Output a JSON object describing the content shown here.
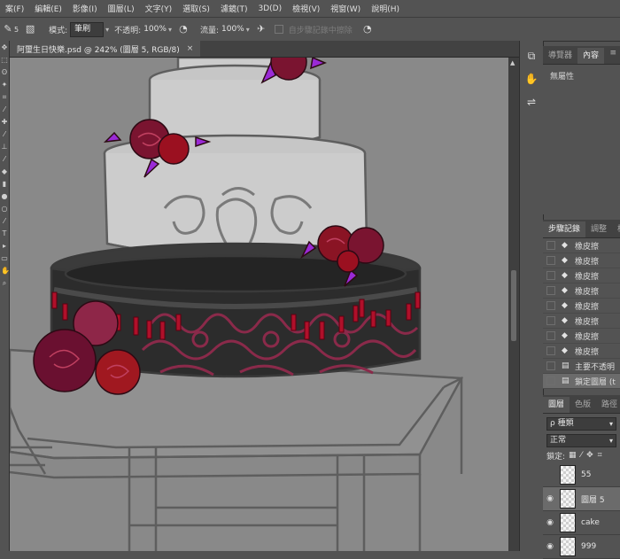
{
  "menu": {
    "items": [
      "案(F)",
      "編輯(E)",
      "影像(I)",
      "圖層(L)",
      "文字(Y)",
      "選取(S)",
      "濾鏡(T)",
      "3D(D)",
      "檢視(V)",
      "視窗(W)",
      "說明(H)"
    ]
  },
  "options": {
    "brush_size": "5",
    "mode_label": "模式:",
    "mode_value": "筆刷",
    "opacity_label": "不透明:",
    "opacity_value": "100%",
    "flow_label": "流量:",
    "flow_value": "100%",
    "erase_history_label": "自步驟記錄中擦除"
  },
  "document": {
    "tab_title": "阿璽生日快樂.psd @ 242% (圖層 5, RGB/8)",
    "close_glyph": "×"
  },
  "panel_top": {
    "tabs": [
      "導覽器",
      "內容"
    ],
    "active_tab": 1,
    "content_text": "無屬性",
    "menu_glyph": "≡"
  },
  "history_panel": {
    "tabs": [
      "步驟記錄",
      "調整",
      "樣"
    ],
    "items": [
      "橡皮擦",
      "橡皮擦",
      "橡皮擦",
      "橡皮擦",
      "橡皮擦",
      "橡皮擦",
      "橡皮擦",
      "橡皮擦",
      "主要不透明",
      "鎖定圖層 (t"
    ],
    "active_index": 9
  },
  "layers_panel": {
    "tabs": [
      "圖層",
      "色版",
      "路徑"
    ],
    "filter_value": "ρ 種類",
    "blend_value": "正常",
    "lock_label": "鎖定:",
    "layers": [
      {
        "name": "55",
        "visible": false
      },
      {
        "name": "圖層 5",
        "visible": true
      },
      {
        "name": "cake",
        "visible": true
      },
      {
        "name": "999",
        "visible": true
      }
    ],
    "selected_index": 1,
    "eye_glyph": "◉"
  },
  "colors": {
    "ui_bg": "#535353",
    "canvas_bg": "#898989",
    "line": "#5e5e5e",
    "cake_white": "#cccccc",
    "cake_dark": "#2c2c2c",
    "bead_red": "#b0102a",
    "rose_red": "#7a1430",
    "leaf_purple": "#9a2ad6"
  }
}
